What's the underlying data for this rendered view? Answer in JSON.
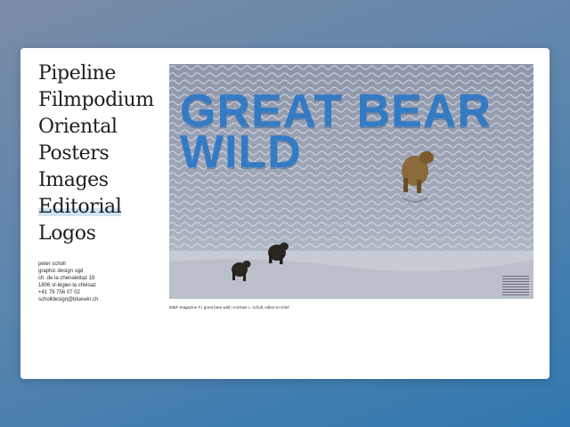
{
  "nav": {
    "items": [
      {
        "label": "Pipeline"
      },
      {
        "label": "Filmpodium"
      },
      {
        "label": "Oriental"
      },
      {
        "label": "Posters"
      },
      {
        "label": "Images"
      },
      {
        "label": "Editorial",
        "active": true
      },
      {
        "label": "Logos"
      }
    ]
  },
  "contact": {
    "name": "peter scholl",
    "title": "graphic design sgd",
    "street": "ch. de la chenalettaz 18",
    "city": "1806 st-légier-la chiésaz",
    "phone": "+41 79 756 07 02",
    "email": "scholldesign@bluewin.ch"
  },
  "feature": {
    "headline_line1": "GREAT BEAR",
    "headline_line2": "WILD",
    "caption": "505F-magazine # | great bear wild | michael c. scholl, editor-in-chief"
  },
  "colors": {
    "accent": "#2a78c6",
    "highlight": "#cfe3f1"
  }
}
